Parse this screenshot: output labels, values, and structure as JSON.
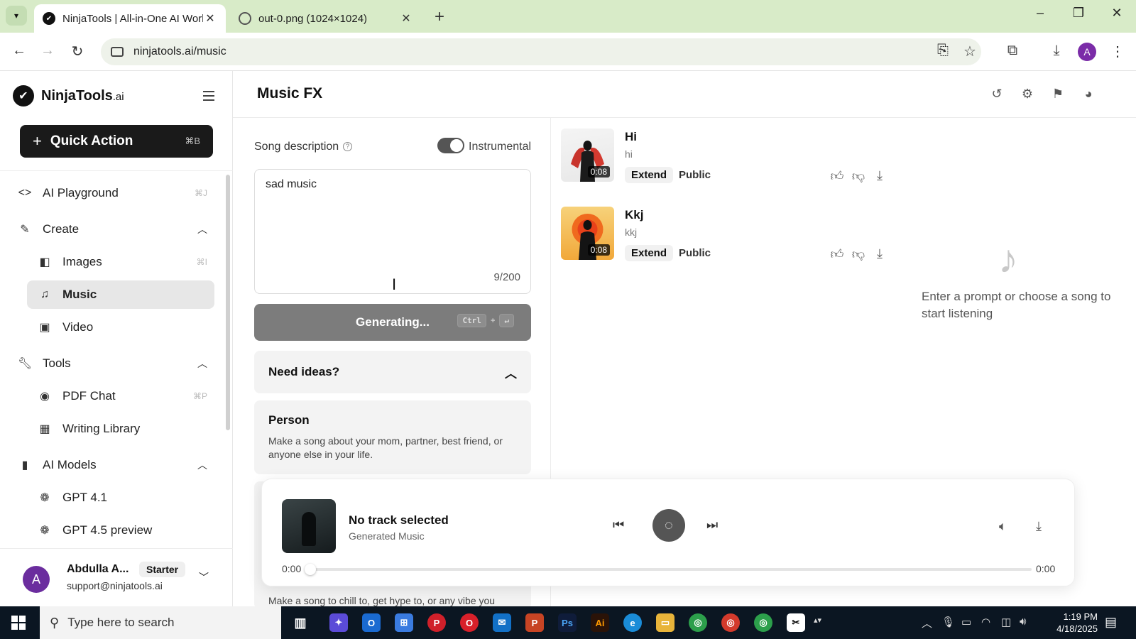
{
  "browser": {
    "tabs": [
      {
        "title": "NinjaTools | All-in-One AI Work",
        "active": true
      },
      {
        "title": "out-0.png (1024×1024)",
        "active": false
      }
    ],
    "url": "ninjatools.ai/music",
    "profile_initial": "A"
  },
  "sidebar": {
    "logo_name": "NinjaTools",
    "logo_suffix": ".ai",
    "quick_action": {
      "label": "Quick Action",
      "shortcut": "⌘B"
    },
    "items": [
      {
        "label": "AI Playground",
        "shortcut": "⌘J",
        "type": "top",
        "icon": "code-icon"
      },
      {
        "label": "Create",
        "type": "section",
        "expanded": true,
        "icon": "brush-icon"
      },
      {
        "label": "Images",
        "shortcut": "⌘I",
        "type": "sub",
        "icon": "images-icon"
      },
      {
        "label": "Music",
        "type": "sub",
        "active": true,
        "icon": "music-icon"
      },
      {
        "label": "Video",
        "type": "sub",
        "icon": "video-icon"
      },
      {
        "label": "Tools",
        "type": "section",
        "expanded": true,
        "icon": "wrench-icon"
      },
      {
        "label": "PDF Chat",
        "shortcut": "⌘P",
        "type": "sub",
        "icon": "pdf-chat-icon"
      },
      {
        "label": "Writing Library",
        "type": "sub",
        "icon": "grid-icon"
      },
      {
        "label": "AI Models",
        "type": "section",
        "expanded": true,
        "icon": "models-icon"
      },
      {
        "label": "GPT 4.1",
        "type": "sub",
        "icon": "openai-icon"
      },
      {
        "label": "GPT 4.5 preview",
        "type": "sub",
        "icon": "openai-icon"
      }
    ],
    "user": {
      "initial": "A",
      "name": "Abdulla A...",
      "plan": "Starter",
      "email": "support@ninjatools.ai"
    }
  },
  "header": {
    "title": "Music FX"
  },
  "form": {
    "description_label": "Song description",
    "instrumental_label": "Instrumental",
    "instrumental_on": true,
    "description_value": "sad music",
    "char_count": "9/200",
    "generate_label": "Generating...",
    "generate_keys": [
      "Ctrl",
      "+",
      "↵"
    ],
    "ideas_label": "Need ideas?",
    "idea_cards": [
      {
        "title": "Person",
        "desc": "Make a song about your mom, partner, best friend, or anyone else in your life."
      }
    ],
    "partial_desc": "Make a song to chill to, get hype to, or any vibe you"
  },
  "songs": [
    {
      "title": "Hi",
      "subtitle": "hi",
      "duration": "0:08",
      "extend_label": "Extend",
      "visibility": "Public"
    },
    {
      "title": "Kkj",
      "subtitle": "kkj",
      "duration": "0:08",
      "extend_label": "Extend",
      "visibility": "Public"
    }
  ],
  "empty_state": {
    "message": "Enter a prompt or choose a song to start listening"
  },
  "player": {
    "track_title": "No track selected",
    "track_subtitle": "Generated Music",
    "time_current": "0:00",
    "time_total": "0:00",
    "progress": 0
  },
  "taskbar": {
    "search_placeholder": "Type here to search",
    "time": "1:19 PM",
    "date": "4/18/2025"
  },
  "colors": {
    "accent": "#1a1a1a",
    "tab_bar": "#d8ebc8",
    "active_nav": "#e7e7e7",
    "taskbar": "#0b1622"
  }
}
